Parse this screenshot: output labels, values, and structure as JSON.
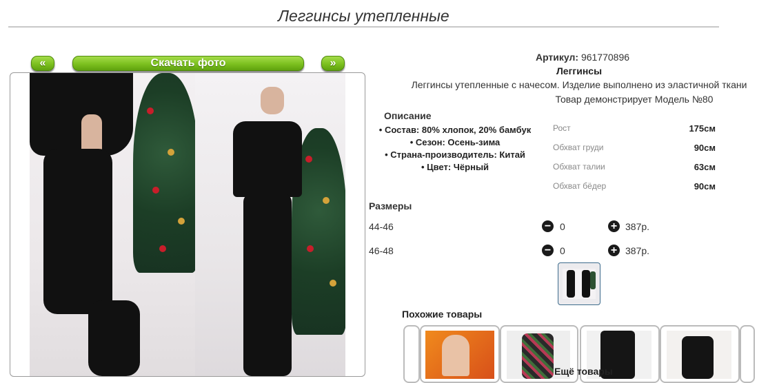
{
  "title": "Леггинсы утепленные",
  "gallery": {
    "prev_label": "«",
    "download_label": "Скачать фото",
    "next_label": "»"
  },
  "product": {
    "sku_label": "Артикул:",
    "sku_value": "961770896",
    "type": "Леггинсы",
    "description": "Леггинсы утепленные с начесом. Изделие выполнено из эластичной ткани",
    "model_note": "Товар демонстрирует Модель №80"
  },
  "description_section": {
    "heading": "Описание",
    "attributes": [
      "Состав: 80% хлопок, 20% бамбук",
      "Сезон: Осень-зима",
      "Страна-производитель: Китай",
      "Цвет: Чёрный"
    ]
  },
  "measurements": [
    {
      "label": "Рост",
      "value": "175см"
    },
    {
      "label": "Обхват груди",
      "value": "90см"
    },
    {
      "label": "Обхват талии",
      "value": "63см"
    },
    {
      "label": "Обхват бёдер",
      "value": "90см"
    }
  ],
  "sizes": {
    "heading": "Размеры",
    "rows": [
      {
        "label": "44-46",
        "qty": "0",
        "price": "387р."
      },
      {
        "label": "46-48",
        "qty": "0",
        "price": "387р."
      }
    ]
  },
  "icons": {
    "minus": "minus-circle-icon",
    "plus": "plus-circle-icon"
  },
  "colors": {
    "accent_green": "#7cc01f",
    "thumb_border": "#3c6b8c"
  },
  "similar": {
    "heading": "Похожие товары",
    "more_caption": "Ещё товары"
  }
}
